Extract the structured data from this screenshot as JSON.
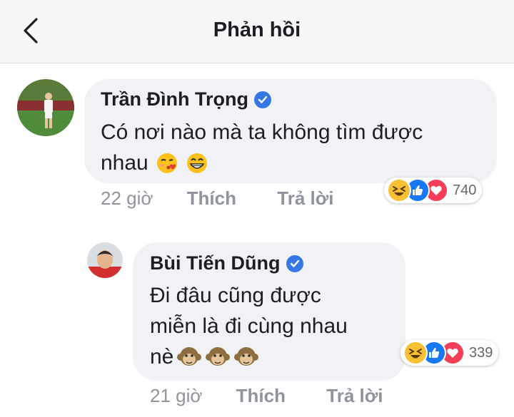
{
  "header": {
    "title": "Phản hồi",
    "back_icon": "chevron-left-icon"
  },
  "comments": [
    {
      "author": "Trần Đình Trọng",
      "verified": true,
      "text_lines": [
        "Có nơi nào mà ta không tìm được",
        "nhau"
      ],
      "emojis": [
        "kissing-heart-emoji",
        "grinning-emoji"
      ],
      "time": "22 giờ",
      "like_label": "Thích",
      "reply_label": "Trả lời",
      "reactions": [
        "haha",
        "like",
        "love"
      ],
      "reaction_count": "740"
    },
    {
      "author": "Bùi Tiến Dũng",
      "verified": true,
      "text_lines": [
        "Đi đâu cũng được",
        "miễn là đi cùng nhau",
        "nè"
      ],
      "emojis": [
        "monkey-emoji",
        "monkey-emoji",
        "monkey-emoji"
      ],
      "time": "21 giờ",
      "like_label": "Thích",
      "reply_label": "Trả lời",
      "reactions": [
        "haha",
        "like",
        "love"
      ],
      "reaction_count": "339"
    }
  ],
  "colors": {
    "header_bg": "#f5f6f7",
    "bubble_bg": "#f0f2f5",
    "verified": "#3578e5",
    "like": "#1877f2",
    "love": "#f33e58",
    "haha": "#f7c035",
    "meta_text": "#90949c"
  }
}
